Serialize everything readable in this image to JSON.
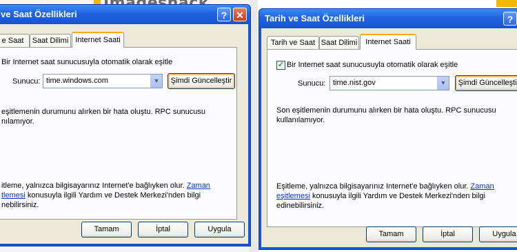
{
  "background": {
    "logo_text": "Imageshack"
  },
  "dialog_left": {
    "title": "ve Saat Özellikleri",
    "tabs": [
      "e Saat",
      "Saat Dilimi",
      "Internet Saati"
    ],
    "checkbox_label": "Bir Internet saat sunucusuyla otomatik olarak eşitle",
    "server_label": "Sunucu:",
    "server_value": "time.windows.com",
    "update_button": "Şimdi Güncelleştir",
    "status_line1": "eşitlemenin durumunu alırken bir hata oluştu.  RPC sunucusu",
    "status_line2": "nılamıyor.",
    "info_line1": "itleme, yalnızca bilgisayarınız Internet'e bağlıyken olur. ",
    "info_link1": "Zaman",
    "info_link2": "tlemesi",
    "info_line2_rest": " konusuyla ilgili Yardım ve Destek Merkezi'nden bilgi",
    "info_line3": "nebilirsiniz.",
    "ok": "Tamam",
    "cancel": "İptal",
    "apply": "Uygula"
  },
  "dialog_right": {
    "title": "Tarih ve Saat Özellikleri",
    "tabs": [
      "Tarih ve Saat",
      "Saat Dilimi",
      "Internet Saati"
    ],
    "checkbox_label": "Bir Internet saat sunucusuyla otomatik olarak eşitle",
    "server_label": "Sunucu:",
    "server_value": "time.nist.gov",
    "update_button": "Şimdi Güncelleştir",
    "status_line1": "Son eşitlemenin durumunu alırken bir hata oluştu.  RPC sunucusu",
    "status_line2": "kullanılamıyor.",
    "info_line1": "Eşitleme, yalnızca bilgisayarınız Internet'e bağlıyken olur. ",
    "info_link1": "Zaman",
    "info_link2": "eşitlemesi",
    "info_line2_rest": " konusuyla ilgili Yardım ve Destek Merkezi'nden bilgi",
    "info_line3": "edinebilirsiniz.",
    "ok": "Tamam",
    "cancel": "İptal",
    "apply": "Uygula"
  },
  "icons": {
    "help": "?",
    "close": "✕",
    "dropdown": "▼",
    "check": "✓"
  },
  "colors": {
    "titlebar": "#1f62e0",
    "dialog_face": "#ece9d8",
    "active_tab_accent": "#f6a923",
    "link": "#0033cc"
  }
}
